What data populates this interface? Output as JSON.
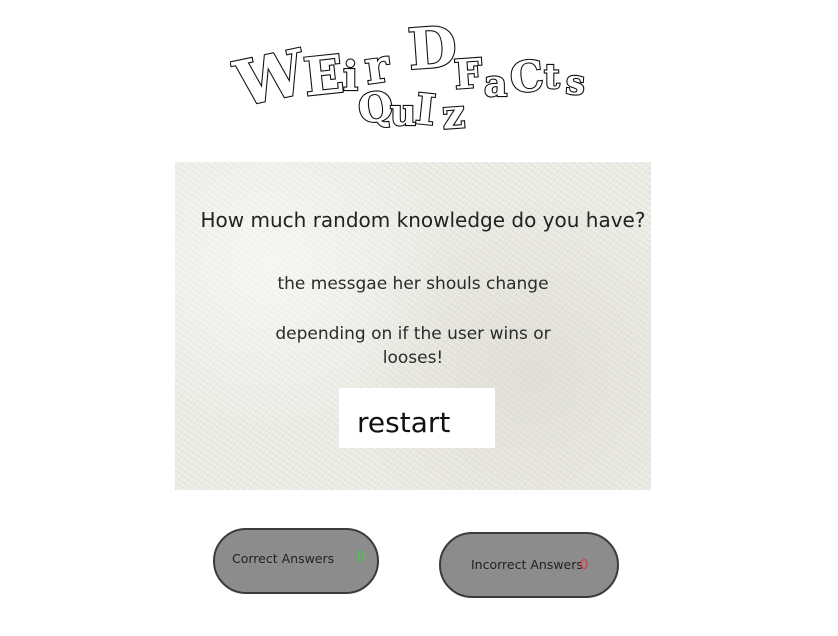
{
  "logo": {
    "letters_top": [
      "W",
      "E",
      "i",
      "r",
      "D"
    ],
    "letters_quiz": [
      "Q",
      "u",
      "I",
      "z"
    ],
    "letters_facts": [
      "F",
      "a",
      "C",
      "t",
      "s"
    ]
  },
  "card": {
    "title": "How much random knowledge do you have?",
    "message_line1": "the messgae her shouls change",
    "message_line2": "depending on if the user wins or looses!",
    "restart_label": "restart"
  },
  "scores": {
    "correct_label": "Correct Answers",
    "correct_value": "0",
    "correct_color": "#3fcf3f",
    "incorrect_label": "Incorrect Answers",
    "incorrect_value": "0",
    "incorrect_color": "#e53935",
    "pill_color": "#8c8c8c"
  }
}
